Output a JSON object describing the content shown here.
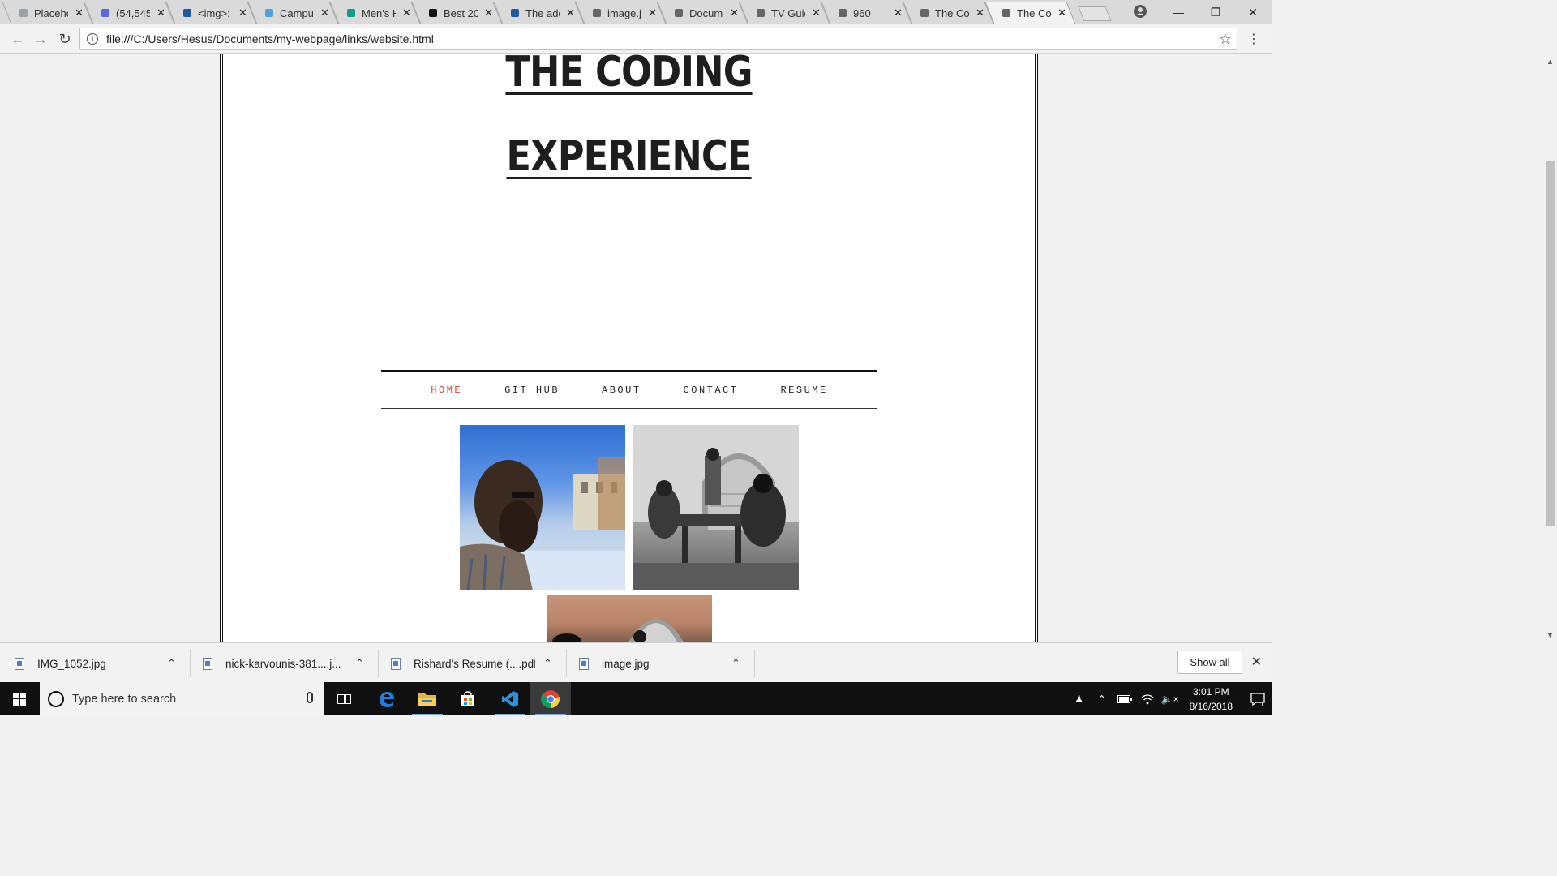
{
  "browser": {
    "tabs": [
      {
        "label": "Placeholder",
        "icon": "placeholder-favicon",
        "color": "#9aa0a6"
      },
      {
        "label": "(54,545",
        "icon": "mail-favicon",
        "color": "#5b6ad8"
      },
      {
        "label": "<img>:",
        "icon": "mdn-favicon",
        "color": "#1e5aa0"
      },
      {
        "label": "Campus",
        "icon": "campus-favicon",
        "color": "#4aa3df"
      },
      {
        "label": "Men's H",
        "icon": "mens-favicon",
        "color": "#0f9d8f"
      },
      {
        "label": "Best 20",
        "icon": "camera-favicon",
        "color": "#111111"
      },
      {
        "label": "The add",
        "icon": "mdn-favicon",
        "color": "#1e5aa0"
      },
      {
        "label": "image.jp",
        "icon": "page-favicon",
        "color": "#666666"
      },
      {
        "label": "Docume",
        "icon": "page-favicon",
        "color": "#666666"
      },
      {
        "label": "TV Guid",
        "icon": "page-favicon",
        "color": "#666666"
      },
      {
        "label": "960",
        "icon": "page-favicon",
        "color": "#666666"
      },
      {
        "label": "The Co",
        "icon": "page-favicon",
        "color": "#666666"
      },
      {
        "label": "The Co",
        "icon": "page-favicon",
        "color": "#666666",
        "active": true
      }
    ],
    "url": "file:///C:/Users/Hesus/Documents/my-webpage/links/website.html"
  },
  "site": {
    "title_line1": "THE CODING",
    "title_line2": "EXPERIENCE",
    "nav": [
      {
        "label": "HOME",
        "active": true
      },
      {
        "label": "GIT HUB",
        "active": false
      },
      {
        "label": "ABOUT",
        "active": false
      },
      {
        "label": "CONTACT",
        "active": false
      },
      {
        "label": "RESUME",
        "active": false
      }
    ],
    "accent": "#d2492b"
  },
  "downloads": {
    "items": [
      {
        "name": "IMG_1052.jpg"
      },
      {
        "name": "nick-karvounis-381....j..."
      },
      {
        "name": "Rishard's Resume (....pdf"
      },
      {
        "name": "image.jpg"
      }
    ],
    "show_all": "Show all"
  },
  "taskbar": {
    "search_placeholder": "Type here to search",
    "time": "3:01 PM",
    "date": "8/16/2018",
    "notifications": "1"
  }
}
